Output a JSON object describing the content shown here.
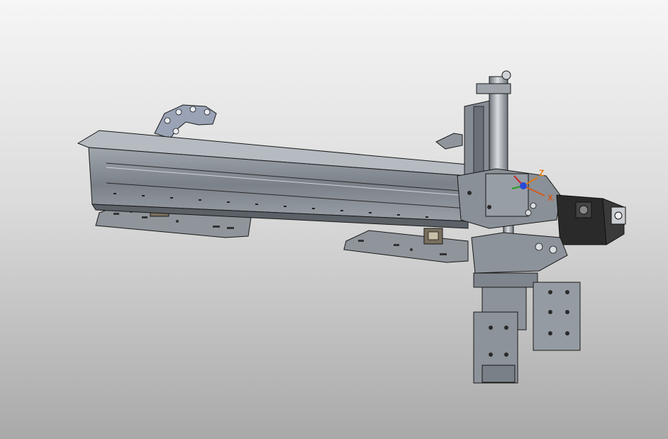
{
  "viewport": {
    "background_top": "#f6f6f6",
    "background_bottom": "#a9a9a9"
  },
  "model": {
    "body_color": "#8a9097",
    "edge_color": "#1a1a1a",
    "chain_color": "#9aa3b5",
    "motor_color": "#2a2a2a"
  },
  "triad": {
    "z_label": "Z",
    "x_label": "X",
    "z_color": "#e07a10",
    "x_color": "#d65a1a",
    "y_color": "#2a4ad8",
    "red_color": "#cc2222",
    "green_color": "#22a022"
  }
}
